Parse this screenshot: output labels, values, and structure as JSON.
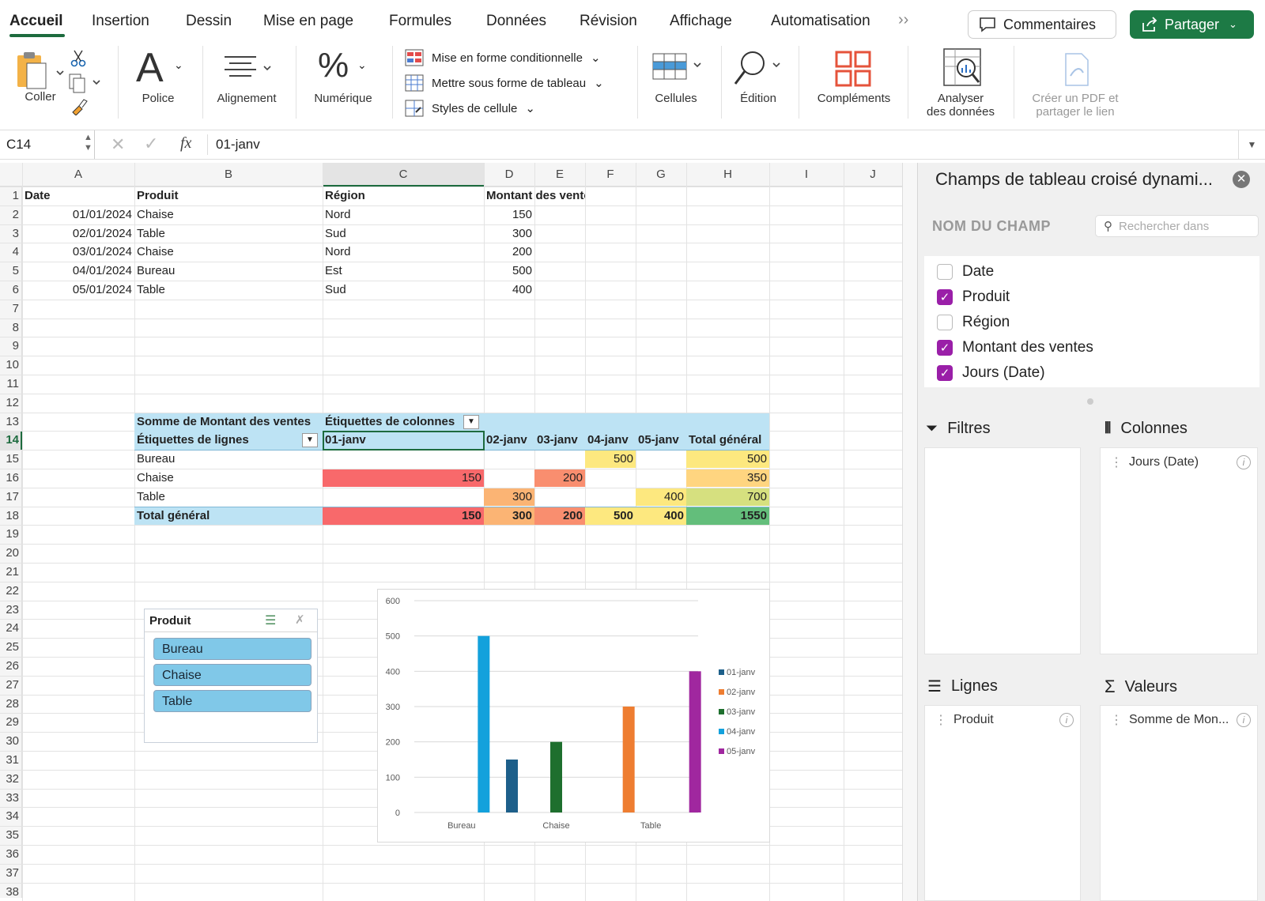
{
  "tabs": [
    "Accueil",
    "Insertion",
    "Dessin",
    "Mise en page",
    "Formules",
    "Données",
    "Révision",
    "Affichage",
    "Automatisation"
  ],
  "header": {
    "comments_label": "Commentaires",
    "share_label": "Partager"
  },
  "ribbon": {
    "paste": "Coller",
    "font": "Police",
    "alignment": "Alignement",
    "number": "Numérique",
    "cond_format": "Mise en forme conditionnelle",
    "format_table": "Mettre sous forme de tableau",
    "cell_styles": "Styles de cellule",
    "cells": "Cellules",
    "editing": "Édition",
    "addins": "Compléments",
    "analyze_1": "Analyser",
    "analyze_2": "des données",
    "pdf_1": "Créer un PDF et",
    "pdf_2": "partager le lien"
  },
  "formula_bar": {
    "cell_ref": "C14",
    "fx": "fx",
    "value": "01-janv"
  },
  "columns": [
    "A",
    "B",
    "C",
    "D",
    "E",
    "F",
    "G",
    "H",
    "I",
    "J"
  ],
  "rows": [
    "1",
    "2",
    "3",
    "4",
    "5",
    "6",
    "7",
    "8",
    "9",
    "10",
    "11",
    "12",
    "13",
    "14",
    "15",
    "16",
    "17",
    "18",
    "19",
    "20",
    "21",
    "22",
    "23",
    "24",
    "25",
    "26",
    "27",
    "28",
    "29",
    "30",
    "31",
    "32",
    "33",
    "34",
    "35",
    "36",
    "37",
    "38"
  ],
  "source_table": {
    "headers": [
      "Date",
      "Produit",
      "Région",
      "Montant des ventes"
    ],
    "rows": [
      [
        "01/01/2024",
        "Chaise",
        "Nord",
        "150"
      ],
      [
        "02/01/2024",
        "Table",
        "Sud",
        "300"
      ],
      [
        "03/01/2024",
        "Chaise",
        "Nord",
        "200"
      ],
      [
        "04/01/2024",
        "Bureau",
        "Est",
        "500"
      ],
      [
        "05/01/2024",
        "Table",
        "Sud",
        "400"
      ]
    ]
  },
  "pivot": {
    "title": "Somme de Montant des ventes",
    "col_labels": "Étiquettes de colonnes",
    "row_labels": "Étiquettes de lignes",
    "dates": [
      "01-janv",
      "02-janv",
      "03-janv",
      "04-janv",
      "05-janv"
    ],
    "total_label": "Total général",
    "rows": [
      {
        "label": "Bureau",
        "values": [
          "",
          "",
          "",
          "500",
          ""
        ],
        "total": "500"
      },
      {
        "label": "Chaise",
        "values": [
          "150",
          "",
          "200",
          "",
          ""
        ],
        "total": "350"
      },
      {
        "label": "Table",
        "values": [
          "",
          "300",
          "",
          "",
          "400"
        ],
        "total": "700"
      }
    ],
    "grand": {
      "values": [
        "150",
        "300",
        "200",
        "500",
        "400"
      ],
      "total": "1550"
    },
    "colors": {
      "header": "#bde3f4",
      "red": "#f8696b",
      "orange": "#fbb474",
      "salmon": "#f98e6f",
      "yellow": "#fde87f",
      "lightgreen": "#d6e07f",
      "green": "#63be7b",
      "gold": "#ffd580"
    }
  },
  "slicer": {
    "title": "Produit",
    "items": [
      "Bureau",
      "Chaise",
      "Table"
    ]
  },
  "chart_data": {
    "type": "bar",
    "categories": [
      "Bureau",
      "Chaise",
      "Table"
    ],
    "series": [
      {
        "name": "01-janv",
        "values": [
          0,
          150,
          0
        ],
        "color": "#1d5f8a"
      },
      {
        "name": "02-janv",
        "values": [
          0,
          0,
          300
        ],
        "color": "#ee7d31"
      },
      {
        "name": "03-janv",
        "values": [
          0,
          200,
          0
        ],
        "color": "#1e6f2e"
      },
      {
        "name": "04-janv",
        "values": [
          500,
          0,
          0
        ],
        "color": "#13a1dc"
      },
      {
        "name": "05-janv",
        "values": [
          0,
          0,
          400
        ],
        "color": "#a0279f"
      }
    ],
    "ylim": [
      0,
      600
    ],
    "yticks": [
      "0",
      "100",
      "200",
      "300",
      "400",
      "500",
      "600"
    ],
    "legend": "right"
  },
  "panel": {
    "title": "Champs de tableau croisé dynami...",
    "field_label": "NOM DU CHAMP",
    "search_placeholder": "Rechercher dans",
    "fields": [
      {
        "name": "Date",
        "checked": false
      },
      {
        "name": "Produit",
        "checked": true
      },
      {
        "name": "Région",
        "checked": false
      },
      {
        "name": "Montant des ventes",
        "checked": true
      },
      {
        "name": "Jours (Date)",
        "checked": true
      }
    ],
    "filters": "Filtres",
    "columns": "Colonnes",
    "rows": "Lignes",
    "values": "Valeurs",
    "columns_item": "Jours (Date)",
    "rows_item": "Produit",
    "values_item": "Somme de Mon..."
  },
  "icons": {
    "comment": "comment-icon",
    "share": "share-icon",
    "search": "search-icon",
    "filter": "filter-icon",
    "sigma": "sigma-icon"
  }
}
